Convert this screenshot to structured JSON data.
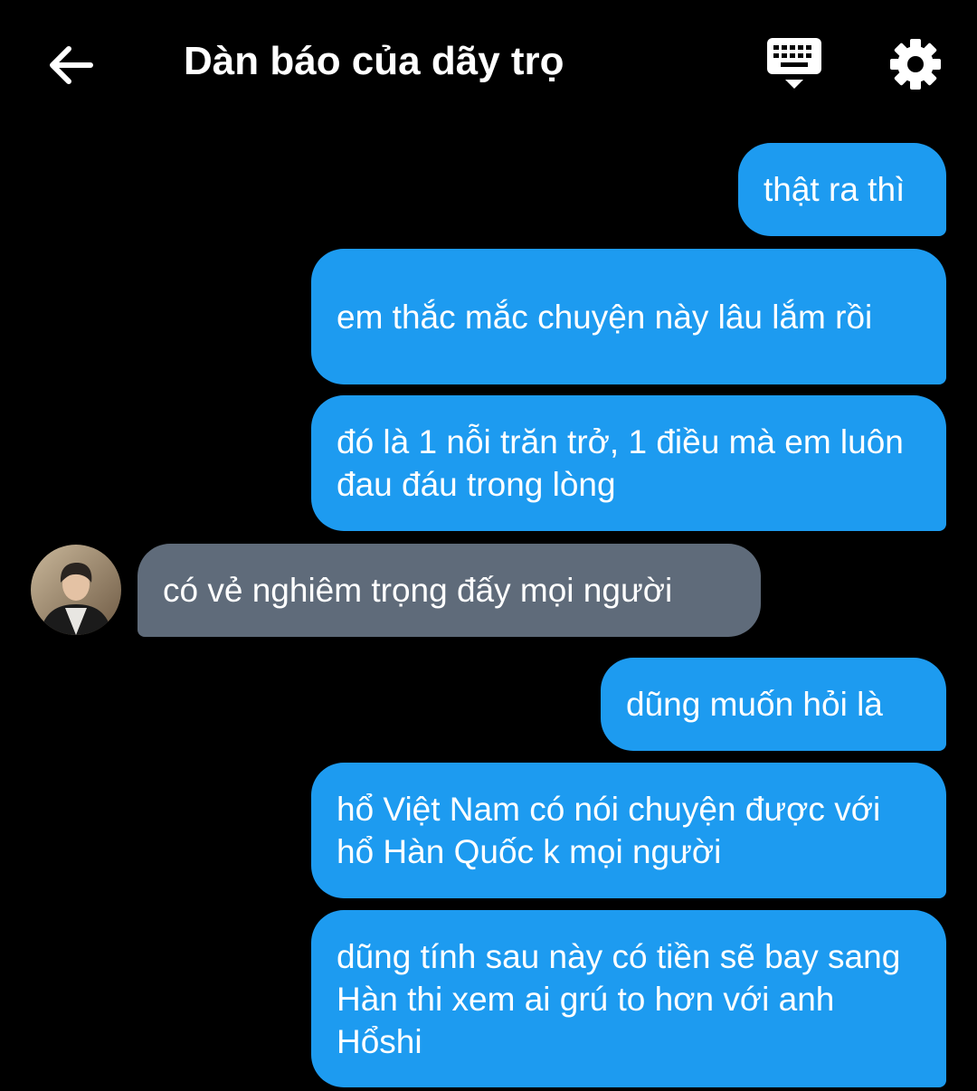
{
  "header": {
    "title": "Dàn báo của dãy trọ",
    "back_icon": "arrow-left-icon",
    "keyboard_icon": "keyboard-icon",
    "settings_icon": "gear-icon"
  },
  "messages": [
    {
      "direction": "outgoing",
      "text": "thật ra thì"
    },
    {
      "direction": "outgoing",
      "text": "em thắc mắc chuyện này lâu lắm rồi"
    },
    {
      "direction": "outgoing",
      "text": "đó là 1 nỗi trăn trở, 1 điều mà em luôn đau đáu trong lòng"
    },
    {
      "direction": "incoming",
      "text": "có vẻ nghiêm trọng đấy mọi người"
    },
    {
      "direction": "outgoing",
      "text": "dũng muốn hỏi là"
    },
    {
      "direction": "outgoing",
      "text": "hổ Việt Nam có nói chuyện được với hổ Hàn Quốc k mọi người"
    },
    {
      "direction": "outgoing",
      "text": "dũng tính sau này có tiền sẽ bay sang Hàn thi xem ai grú to hơn với anh Hổshi"
    }
  ],
  "colors": {
    "background": "#000000",
    "outgoing_bubble": "#1d9bf0",
    "incoming_bubble": "#5f6b7a",
    "text": "#ffffff"
  }
}
